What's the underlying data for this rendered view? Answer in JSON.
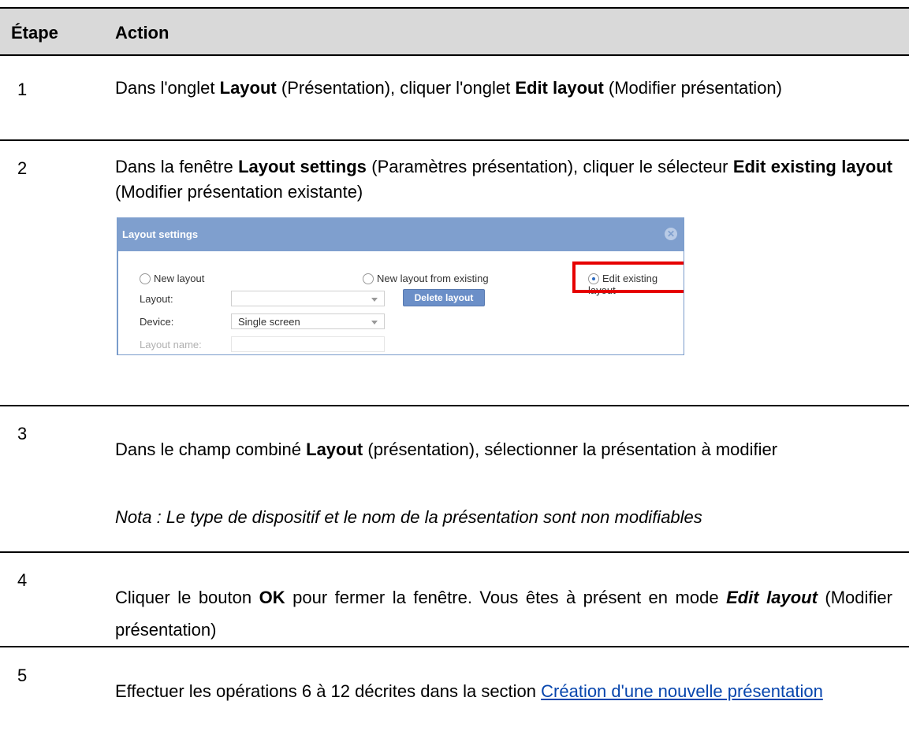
{
  "header": {
    "col_step": "Étape",
    "col_action": "Action"
  },
  "steps": [
    {
      "num": "1",
      "parts": [
        "Dans l'onglet ",
        "Layout",
        " (Présentation), cliquer l'onglet ",
        "Edit layout",
        " (Modifier présentation)"
      ]
    },
    {
      "num": "2",
      "parts": [
        "Dans la fenêtre ",
        "Layout settings",
        " (Paramètres présentation), cliquer le sélecteur ",
        "Edit existing layout",
        " (Modifier présentation existante)"
      ]
    },
    {
      "num": "3",
      "parts": [
        "Dans le champ combiné ",
        "Layout",
        " (présentation), sélectionner la présentation à modifier"
      ],
      "note": "Nota : Le type de dispositif et le nom de la présentation sont non modifiables"
    },
    {
      "num": "4",
      "parts": [
        "Cliquer le bouton ",
        "OK",
        " pour fermer la fenêtre. Vous êtes à présent en mode ",
        "Edit layout",
        " (Modifier présentation)"
      ]
    },
    {
      "num": "5",
      "parts": [
        "Effectuer les opérations 6 à 12 décrites dans la section ",
        "Création d'une nouvelle présentation"
      ]
    }
  ],
  "dialog": {
    "title": "Layout settings",
    "close_icon": "close-icon",
    "radio_new": "New layout",
    "radio_from_existing": "New layout from existing",
    "radio_edit_existing": "Edit existing layout",
    "selected_radio": "Edit existing layout",
    "layout_label": "Layout:",
    "layout_value": "",
    "delete_button": "Delete layout",
    "device_label": "Device:",
    "device_value": "Single screen",
    "layout_name_label": "Layout name:",
    "layout_name_value": "",
    "highlight_color": "#e60000",
    "title_bar_color": "#7f9fce"
  }
}
